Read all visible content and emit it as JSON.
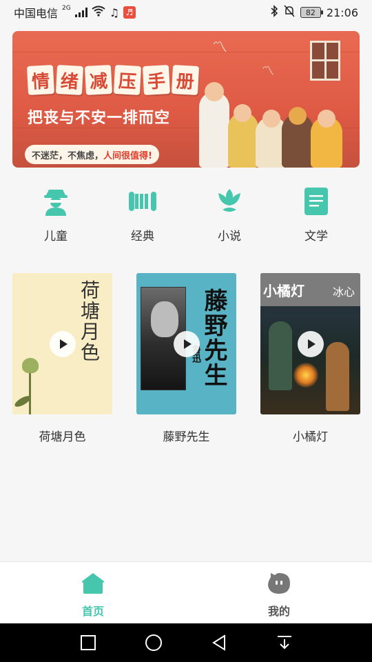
{
  "status_bar": {
    "carrier": "中国电信",
    "network": "2G",
    "time": "21:06",
    "battery": "82"
  },
  "banner": {
    "title_chars": [
      "情",
      "绪",
      "减",
      "压",
      "手",
      "册"
    ],
    "subtitle": "把丧与不安一排而空",
    "slogan_plain": "不迷茫，不焦虑，",
    "slogan_highlight": "人间很值得!"
  },
  "categories": [
    {
      "label": "儿童",
      "icon": "child-detective-icon"
    },
    {
      "label": "经典",
      "icon": "scroll-icon"
    },
    {
      "label": "小说",
      "icon": "lotus-icon"
    },
    {
      "label": "文学",
      "icon": "document-icon"
    }
  ],
  "books": [
    {
      "title": "荷塘月色",
      "cover_title": "荷塘月色"
    },
    {
      "title": "藤野先生",
      "cover_title": "藤野先生",
      "cover_author": "鲁迅"
    },
    {
      "title": "小橘灯",
      "cover_title": "小橘灯",
      "cover_author": "冰心"
    }
  ],
  "bottom_nav": {
    "home": "首页",
    "mine": "我的"
  },
  "colors": {
    "accent": "#45c6ad",
    "banner": "#e3634c",
    "highlight": "#e23b2a"
  }
}
